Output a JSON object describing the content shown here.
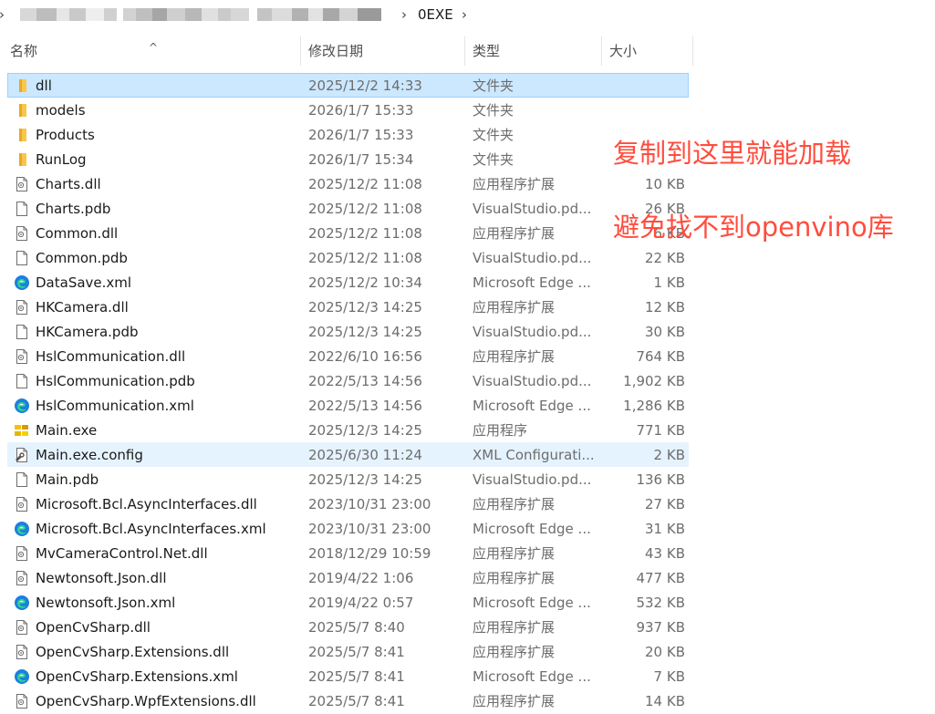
{
  "breadcrumb": {
    "current": "0EXE",
    "sep": "›"
  },
  "columns": {
    "name": "名称",
    "date": "修改日期",
    "type": "类型",
    "size": "大小"
  },
  "annotations": [
    "复制到这里就能加载",
    "避免找不到openvino库"
  ],
  "colors": {
    "annotation": "#ff4d3d",
    "selected_bg": "#cce8ff",
    "folder": "#f8c74a",
    "edge": "#1b7fe0"
  },
  "files": [
    {
      "name": "dll",
      "date": "2025/12/2 14:33",
      "type": "文件夹",
      "size": "",
      "icon": "folder-icon",
      "state": "selected"
    },
    {
      "name": "models",
      "date": "2026/1/7 15:33",
      "type": "文件夹",
      "size": "",
      "icon": "folder-icon",
      "state": ""
    },
    {
      "name": "Products",
      "date": "2026/1/7 15:33",
      "type": "文件夹",
      "size": "",
      "icon": "folder-icon",
      "state": ""
    },
    {
      "name": "RunLog",
      "date": "2026/1/7 15:34",
      "type": "文件夹",
      "size": "",
      "icon": "folder-icon",
      "state": ""
    },
    {
      "name": "Charts.dll",
      "date": "2025/12/2 11:08",
      "type": "应用程序扩展",
      "size": "10 KB",
      "icon": "dll-icon",
      "state": ""
    },
    {
      "name": "Charts.pdb",
      "date": "2025/12/2 11:08",
      "type": "VisualStudio.pd...",
      "size": "26 KB",
      "icon": "file-icon",
      "state": ""
    },
    {
      "name": "Common.dll",
      "date": "2025/12/2 11:08",
      "type": "应用程序扩展",
      "size": "6 KB",
      "icon": "dll-icon",
      "state": ""
    },
    {
      "name": "Common.pdb",
      "date": "2025/12/2 11:08",
      "type": "VisualStudio.pd...",
      "size": "22 KB",
      "icon": "file-icon",
      "state": ""
    },
    {
      "name": "DataSave.xml",
      "date": "2025/12/2 10:34",
      "type": "Microsoft Edge ...",
      "size": "1 KB",
      "icon": "edge-icon",
      "state": ""
    },
    {
      "name": "HKCamera.dll",
      "date": "2025/12/3 14:25",
      "type": "应用程序扩展",
      "size": "12 KB",
      "icon": "dll-icon",
      "state": ""
    },
    {
      "name": "HKCamera.pdb",
      "date": "2025/12/3 14:25",
      "type": "VisualStudio.pd...",
      "size": "30 KB",
      "icon": "file-icon",
      "state": ""
    },
    {
      "name": "HslCommunication.dll",
      "date": "2022/6/10 16:56",
      "type": "应用程序扩展",
      "size": "764 KB",
      "icon": "dll-icon",
      "state": ""
    },
    {
      "name": "HslCommunication.pdb",
      "date": "2022/5/13 14:56",
      "type": "VisualStudio.pd...",
      "size": "1,902 KB",
      "icon": "file-icon",
      "state": ""
    },
    {
      "name": "HslCommunication.xml",
      "date": "2022/5/13 14:56",
      "type": "Microsoft Edge ...",
      "size": "1,286 KB",
      "icon": "edge-icon",
      "state": ""
    },
    {
      "name": "Main.exe",
      "date": "2025/12/3 14:25",
      "type": "应用程序",
      "size": "771 KB",
      "icon": "exe-icon",
      "state": ""
    },
    {
      "name": "Main.exe.config",
      "date": "2025/6/30 11:24",
      "type": "XML Configurati...",
      "size": "2 KB",
      "icon": "config-icon",
      "state": "hover"
    },
    {
      "name": "Main.pdb",
      "date": "2025/12/3 14:25",
      "type": "VisualStudio.pd...",
      "size": "136 KB",
      "icon": "file-icon",
      "state": ""
    },
    {
      "name": "Microsoft.Bcl.AsyncInterfaces.dll",
      "date": "2023/10/31 23:00",
      "type": "应用程序扩展",
      "size": "27 KB",
      "icon": "dll-icon",
      "state": ""
    },
    {
      "name": "Microsoft.Bcl.AsyncInterfaces.xml",
      "date": "2023/10/31 23:00",
      "type": "Microsoft Edge ...",
      "size": "31 KB",
      "icon": "edge-icon",
      "state": ""
    },
    {
      "name": "MvCameraControl.Net.dll",
      "date": "2018/12/29 10:59",
      "type": "应用程序扩展",
      "size": "43 KB",
      "icon": "dll-icon",
      "state": ""
    },
    {
      "name": "Newtonsoft.Json.dll",
      "date": "2019/4/22 1:06",
      "type": "应用程序扩展",
      "size": "477 KB",
      "icon": "dll-icon",
      "state": ""
    },
    {
      "name": "Newtonsoft.Json.xml",
      "date": "2019/4/22 0:57",
      "type": "Microsoft Edge ...",
      "size": "532 KB",
      "icon": "edge-icon",
      "state": ""
    },
    {
      "name": "OpenCvSharp.dll",
      "date": "2025/5/7 8:40",
      "type": "应用程序扩展",
      "size": "937 KB",
      "icon": "dll-icon",
      "state": ""
    },
    {
      "name": "OpenCvSharp.Extensions.dll",
      "date": "2025/5/7 8:41",
      "type": "应用程序扩展",
      "size": "20 KB",
      "icon": "dll-icon",
      "state": ""
    },
    {
      "name": "OpenCvSharp.Extensions.xml",
      "date": "2025/5/7 8:41",
      "type": "Microsoft Edge ...",
      "size": "7 KB",
      "icon": "edge-icon",
      "state": ""
    },
    {
      "name": "OpenCvSharp.WpfExtensions.dll",
      "date": "2025/5/7 8:41",
      "type": "应用程序扩展",
      "size": "14 KB",
      "icon": "dll-icon",
      "state": ""
    }
  ]
}
